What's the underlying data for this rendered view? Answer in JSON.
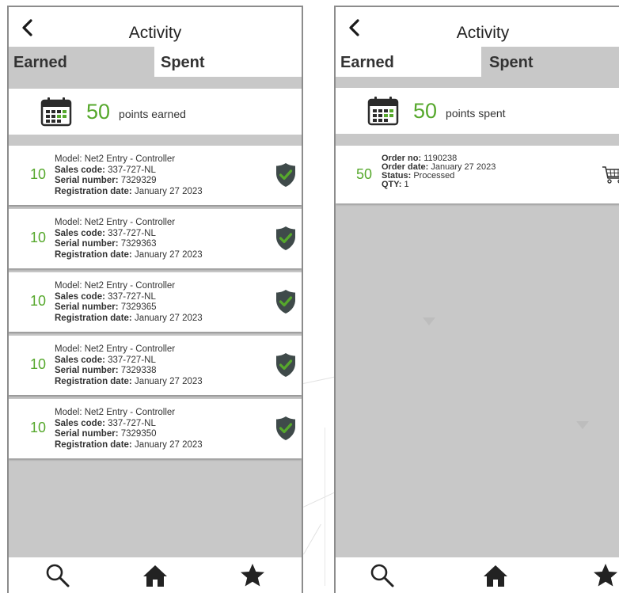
{
  "screens": [
    {
      "title": "Activity",
      "tabs": {
        "earned": "Earned",
        "spent": "Spent",
        "active": "earned"
      },
      "summary": {
        "points": "50",
        "label": "points earned"
      },
      "items": [
        {
          "points": "10",
          "model_label": "Model:",
          "model": "Net2 Entry - Controller",
          "sales_label": "Sales code:",
          "sales": "337-727-NL",
          "serial_label": "Serial number:",
          "serial": "7329329",
          "reg_label": "Registration date:",
          "reg": "January 27 2023"
        },
        {
          "points": "10",
          "model_label": "Model:",
          "model": "Net2 Entry - Controller",
          "sales_label": "Sales code:",
          "sales": "337-727-NL",
          "serial_label": "Serial number:",
          "serial": "7329363",
          "reg_label": "Registration date:",
          "reg": "January 27 2023"
        },
        {
          "points": "10",
          "model_label": "Model:",
          "model": "Net2 Entry - Controller",
          "sales_label": "Sales code:",
          "sales": "337-727-NL",
          "serial_label": "Serial number:",
          "serial": "7329365",
          "reg_label": "Registration date:",
          "reg": "January 27 2023"
        },
        {
          "points": "10",
          "model_label": "Model:",
          "model": "Net2 Entry - Controller",
          "sales_label": "Sales code:",
          "sales": "337-727-NL",
          "serial_label": "Serial number:",
          "serial": "7329338",
          "reg_label": "Registration date:",
          "reg": "January 27 2023"
        },
        {
          "points": "10",
          "model_label": "Model:",
          "model": "Net2 Entry - Controller",
          "sales_label": "Sales code:",
          "sales": "337-727-NL",
          "serial_label": "Serial number:",
          "serial": "7329350",
          "reg_label": "Registration date:",
          "reg": "January 27 2023"
        }
      ]
    },
    {
      "title": "Activity",
      "tabs": {
        "earned": "Earned",
        "spent": "Spent",
        "active": "spent"
      },
      "summary": {
        "points": "50",
        "label": "points spent"
      },
      "order": {
        "points": "50",
        "order_no_label": "Order no:",
        "order_no": "1190238",
        "order_date_label": "Order date:",
        "order_date": "January 27 2023",
        "status_label": "Status:",
        "status": "Processed",
        "qty_label": "QTY:",
        "qty": "1"
      }
    }
  ],
  "icons": {
    "back": "chevron-left-icon",
    "calendar": "calendar-icon",
    "verified": "shield-check-icon",
    "cart": "shopping-cart-icon",
    "search": "search-icon",
    "home": "home-icon",
    "favorites": "star-icon"
  },
  "colors": {
    "accent_green": "#56a82c",
    "shield_dark": "#3f4a4a",
    "tab_inactive": "#c8c8c8",
    "background_grey": "#c8c8c8"
  }
}
